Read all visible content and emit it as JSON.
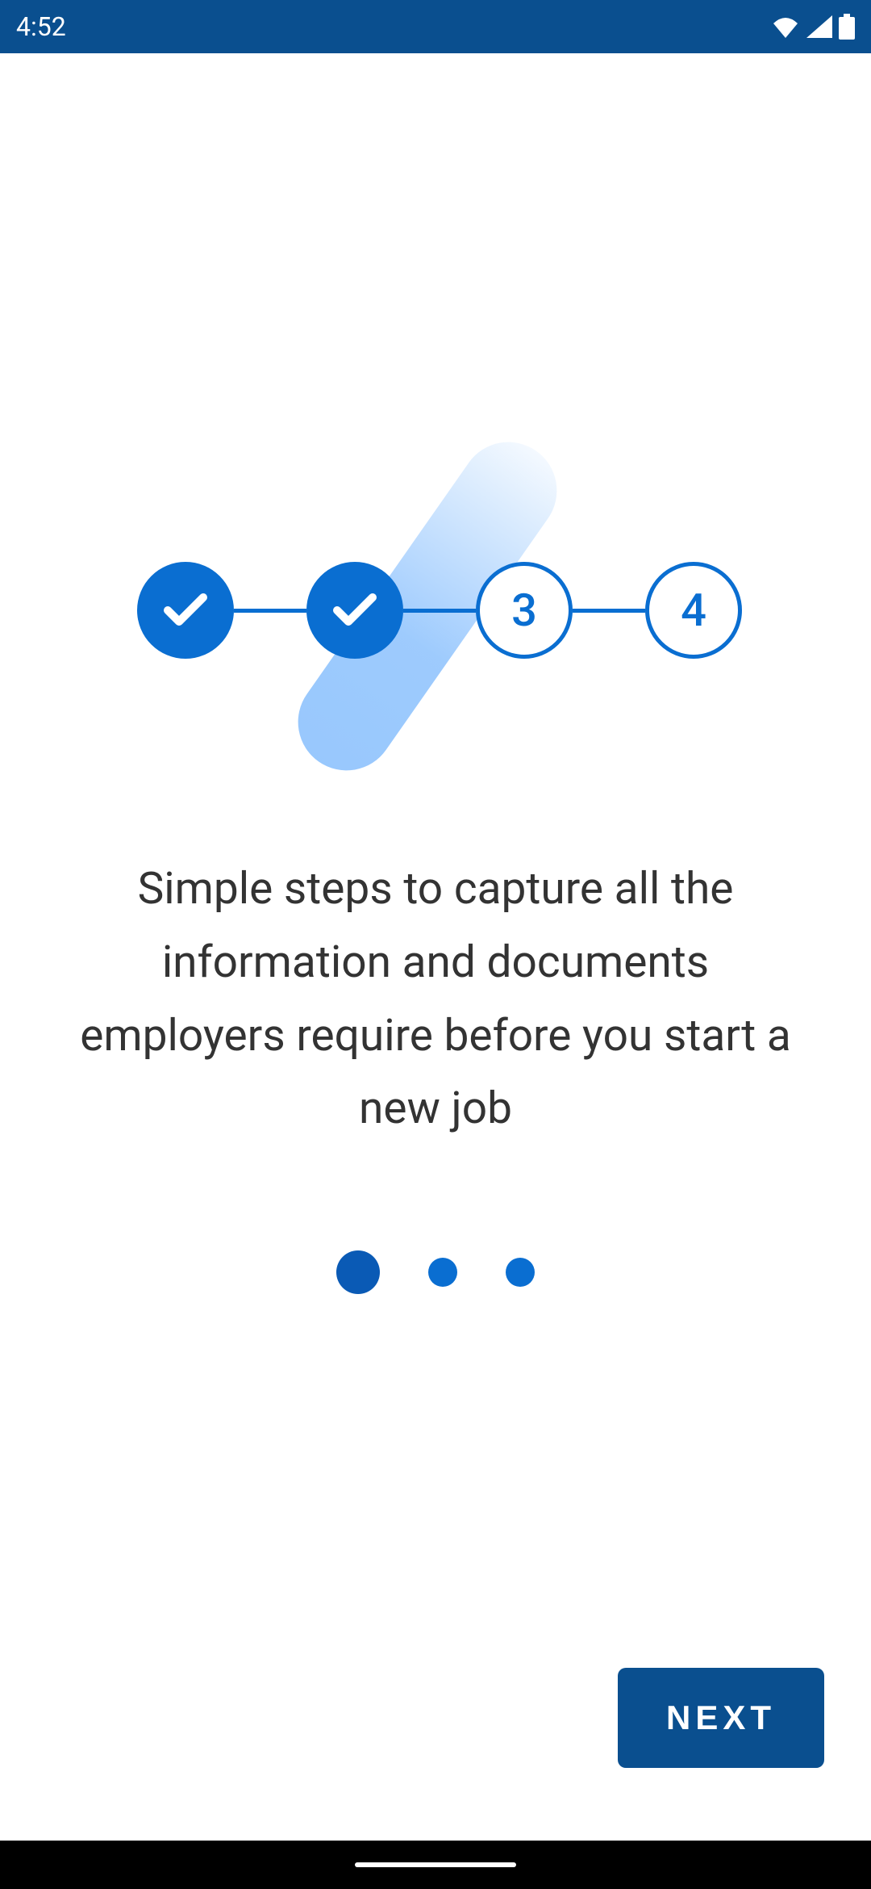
{
  "status_bar": {
    "time": "4:52"
  },
  "onboarding": {
    "steps": {
      "step3_label": "3",
      "step4_label": "4"
    },
    "description": "Simple steps to capture all the information and documents employers require before you start a new job",
    "next_button_label": "NEXT",
    "page_indicator": {
      "total": 3,
      "active": 1
    }
  },
  "colors": {
    "primary": "#0a6ed1",
    "status_bar": "#0a4f8f",
    "button": "#0a4f8f"
  }
}
